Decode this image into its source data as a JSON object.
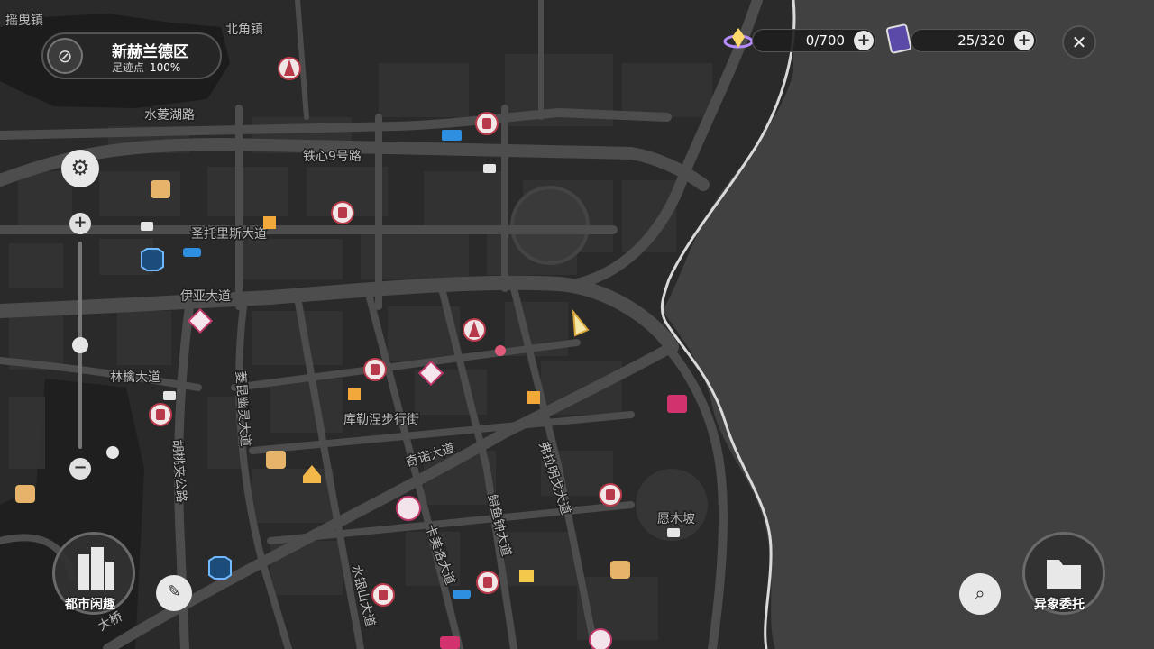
{
  "region": {
    "name": "新赫兰德区",
    "progress_label": "足迹点",
    "progress_value": "100%"
  },
  "resources": [
    {
      "name": "resource-a",
      "value": "0/700"
    },
    {
      "name": "resource-b",
      "value": "25/320"
    }
  ],
  "map_labels": {
    "yaoguizhen": "摇曳镇",
    "beijiaozhen": "北角镇",
    "shuilinghu": "水菱湖路",
    "tiexin9": "铁心9号路",
    "shengtuoli": "圣托里斯大道",
    "yiya": "伊亚大道",
    "linqin": "林檎大道",
    "kulesa": "库勒涅步行街",
    "qinuo": "奇诺大道",
    "fulaming": "弗拉明戈大道",
    "yumujiang": "愿木坡",
    "hutaojia": "胡桃夹公路",
    "linglong": "菱昆幽灵大道",
    "kameiluo": "卡美洛大道",
    "zhenyu": "鲟鱼钟大道",
    "shuiyinshan": "水银山大道",
    "bridge": "大桥"
  },
  "buttons": {
    "city_fun": "都市闲趣",
    "anomaly": "异象委托"
  },
  "icons": {
    "compass": "compass-icon",
    "settings": "gear-icon",
    "close": "close-icon",
    "notes": "notes-icon",
    "search_map": "map-search-icon"
  },
  "colors": {
    "map_bg": "#2b2b2b",
    "water": "#3d3d3d",
    "road": "#4a4a4a",
    "poi_red": "#b83a4a",
    "poi_blue": "#2a7fc9",
    "poi_orange": "#e5a640"
  }
}
